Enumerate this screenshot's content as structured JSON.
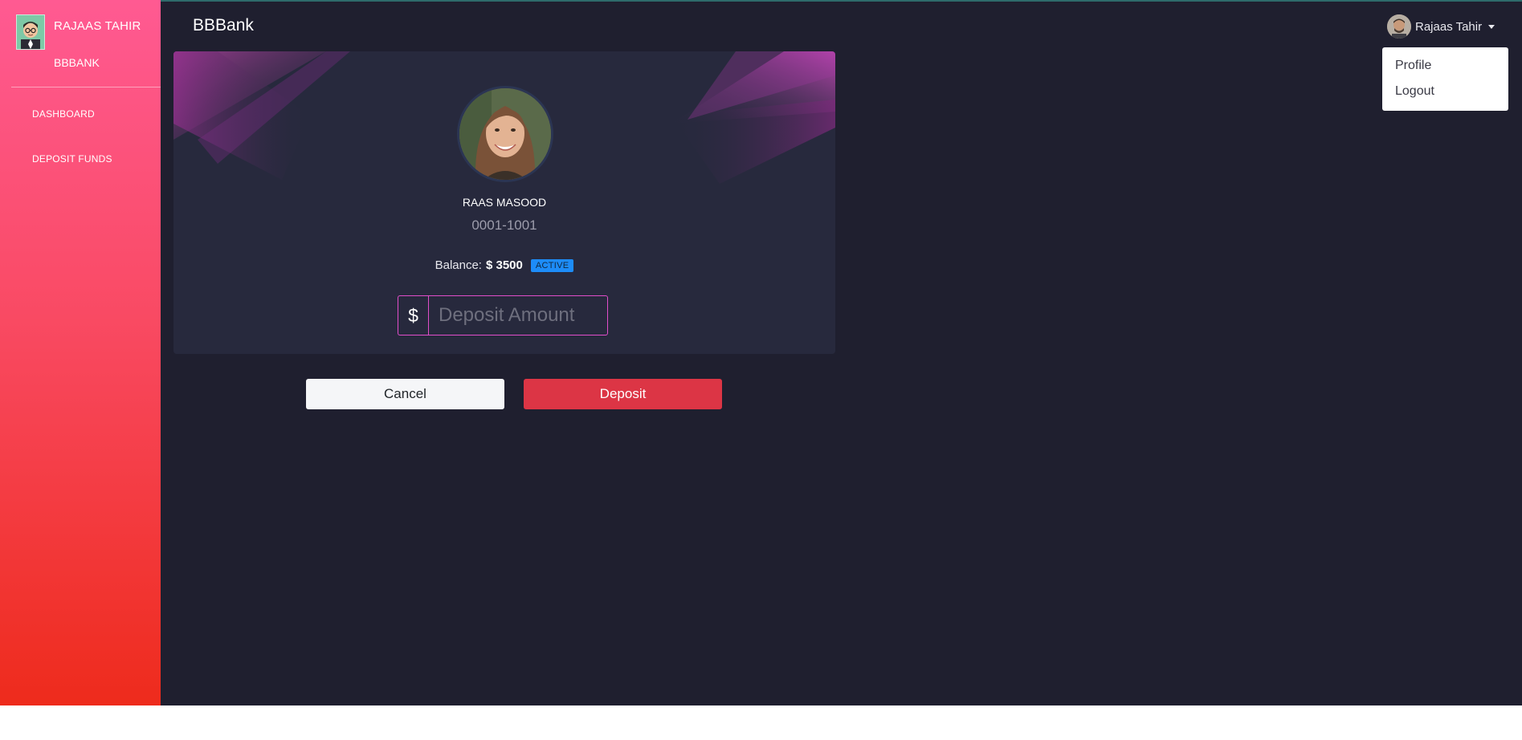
{
  "sidebar": {
    "user_name": "RAJAAS TAHIR",
    "brand": "BBBANK",
    "items": [
      {
        "label": "DASHBOARD"
      },
      {
        "label": "DEPOSIT FUNDS"
      }
    ]
  },
  "header": {
    "title": "BBBank",
    "user_name": "Rajaas Tahir",
    "menu": [
      {
        "label": "Profile"
      },
      {
        "label": "Logout"
      }
    ]
  },
  "account": {
    "holder_name": "RAAS MASOOD",
    "account_number": "0001-1001",
    "balance_label": "Balance:",
    "balance_value": "$ 3500",
    "status": "ACTIVE",
    "currency_symbol": "$",
    "deposit_placeholder": "Deposit Amount",
    "deposit_value": ""
  },
  "actions": {
    "cancel_label": "Cancel",
    "deposit_label": "Deposit"
  },
  "colors": {
    "background": "#1f1f2f",
    "card": "#27293d",
    "accent": "#e14eca",
    "danger": "#dc3545",
    "info": "#1d8cf8",
    "sidebar_top": "#ff5a92",
    "sidebar_bottom": "#ee2b1c"
  }
}
